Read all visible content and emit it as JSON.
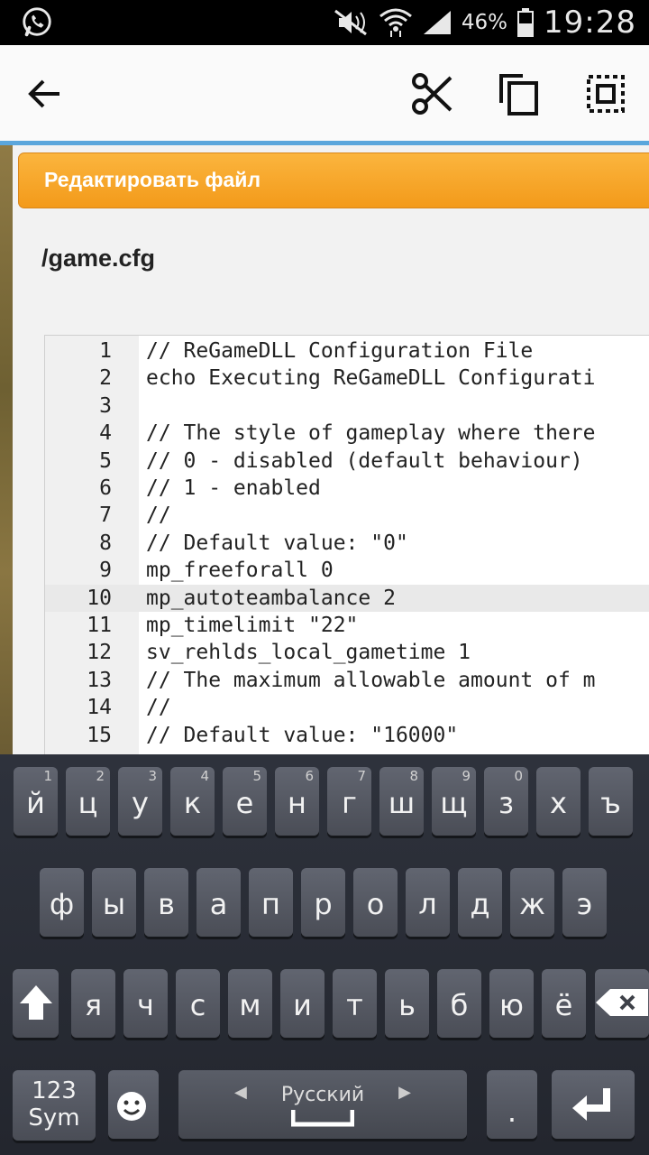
{
  "status_bar": {
    "battery_percent": "46%",
    "time": "19:28",
    "icons": [
      "whatsapp-icon",
      "mute-icon",
      "wifi-icon",
      "signal-icon",
      "battery-icon"
    ]
  },
  "action_bar": {
    "icons": [
      "back-arrow-icon",
      "cut-icon",
      "copy-icon",
      "select-all-icon"
    ]
  },
  "dialog": {
    "title": "Редактировать файл",
    "filename": "/game.cfg",
    "accent_color": "#f5a623"
  },
  "editor": {
    "highlighted_line": 10,
    "lines": [
      {
        "num": "1",
        "text": "// ReGameDLL Configuration File"
      },
      {
        "num": "2",
        "text": "echo Executing ReGameDLL Configurati"
      },
      {
        "num": "3",
        "text": ""
      },
      {
        "num": "4",
        "text": "// The style of gameplay where there"
      },
      {
        "num": "5",
        "text": "// 0 - disabled (default behaviour)"
      },
      {
        "num": "6",
        "text": "// 1 - enabled"
      },
      {
        "num": "7",
        "text": "//"
      },
      {
        "num": "8",
        "text": "// Default value: \"0\""
      },
      {
        "num": "9",
        "text": "mp_freeforall 0"
      },
      {
        "num": "10",
        "text": "mp_autoteambalance 2"
      },
      {
        "num": "11",
        "text": "mp_timelimit \"22\""
      },
      {
        "num": "12",
        "text": "sv_rehlds_local_gametime 1"
      },
      {
        "num": "13",
        "text": "// The maximum allowable amount of m"
      },
      {
        "num": "14",
        "text": "//"
      },
      {
        "num": "15",
        "text": "// Default value: \"16000\""
      }
    ]
  },
  "keyboard": {
    "row1": [
      {
        "k": "й",
        "h": "1"
      },
      {
        "k": "ц",
        "h": "2"
      },
      {
        "k": "у",
        "h": "3"
      },
      {
        "k": "к",
        "h": "4"
      },
      {
        "k": "е",
        "h": "5"
      },
      {
        "k": "н",
        "h": "6"
      },
      {
        "k": "г",
        "h": "7"
      },
      {
        "k": "ш",
        "h": "8"
      },
      {
        "k": "щ",
        "h": "9"
      },
      {
        "k": "з",
        "h": "0"
      },
      {
        "k": "х",
        "h": ""
      },
      {
        "k": "ъ",
        "h": ""
      }
    ],
    "row2": [
      "ф",
      "ы",
      "в",
      "а",
      "п",
      "р",
      "о",
      "л",
      "д",
      "ж",
      "э"
    ],
    "row3": [
      "я",
      "ч",
      "с",
      "м",
      "и",
      "т",
      "ь",
      "б",
      "ю",
      "ё"
    ],
    "sym_top": "123",
    "sym_bottom": "Sym",
    "language": "Русский",
    "period_key": "."
  }
}
